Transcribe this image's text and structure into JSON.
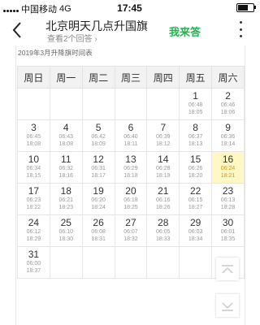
{
  "status_bar": {
    "carrier": "中国移动",
    "network": "4G",
    "time": "17:45"
  },
  "header": {
    "title": "北京明天几点升国旗",
    "subtitle": "查看2个回答",
    "subtitle_chevron": "›",
    "answer_button": "我来答",
    "back_icon": "chevron-left-icon",
    "more_icon": "more-vertical-icon"
  },
  "calendar": {
    "caption": "2019年3月升降旗时间表",
    "weekdays": [
      "周日",
      "周一",
      "周二",
      "周三",
      "周四",
      "周五",
      "周六"
    ],
    "highlight_day": "16",
    "highlight_color": "#fff8c4",
    "accent_color": "#1db84f",
    "weeks": [
      [
        null,
        null,
        null,
        null,
        null,
        {
          "day": "1",
          "rise": "06:48",
          "set": "18:05"
        },
        {
          "day": "2",
          "rise": "06:46",
          "set": "18:06"
        }
      ],
      [
        {
          "day": "3",
          "rise": "06:45",
          "set": "18:08"
        },
        {
          "day": "4",
          "rise": "06:43",
          "set": "18:08"
        },
        {
          "day": "5",
          "rise": "06:42",
          "set": "18:09"
        },
        {
          "day": "6",
          "rise": "06:40",
          "set": "18:11"
        },
        {
          "day": "7",
          "rise": "06:39",
          "set": "18:12"
        },
        {
          "day": "8",
          "rise": "06:37",
          "set": "18:13"
        },
        {
          "day": "9",
          "rise": "06:36",
          "set": "18:14"
        }
      ],
      [
        {
          "day": "10",
          "rise": "06:34",
          "set": "18:15"
        },
        {
          "day": "11",
          "rise": "06:32",
          "set": "18:16"
        },
        {
          "day": "12",
          "rise": "06:31",
          "set": "18:17"
        },
        {
          "day": "13",
          "rise": "06:29",
          "set": "18:18"
        },
        {
          "day": "14",
          "rise": "06:28",
          "set": "18:19"
        },
        {
          "day": "15",
          "rise": "06:26",
          "set": "18:20"
        },
        {
          "day": "16",
          "rise": "06:24",
          "set": "18:21"
        }
      ],
      [
        {
          "day": "17",
          "rise": "06:23",
          "set": "18:22"
        },
        {
          "day": "18",
          "rise": "06:21",
          "set": "18:23"
        },
        {
          "day": "19",
          "rise": "06:20",
          "set": "18:24"
        },
        {
          "day": "20",
          "rise": "06:18",
          "set": "18:25"
        },
        {
          "day": "21",
          "rise": "06:16",
          "set": "18:26"
        },
        {
          "day": "22",
          "rise": "06:15",
          "set": "18:27"
        },
        {
          "day": "23",
          "rise": "06:13",
          "set": "18:28"
        }
      ],
      [
        {
          "day": "24",
          "rise": "06:12",
          "set": "18:29"
        },
        {
          "day": "25",
          "rise": "06:10",
          "set": "18:30"
        },
        {
          "day": "26",
          "rise": "06:08",
          "set": "18:31"
        },
        {
          "day": "27",
          "rise": "06:07",
          "set": "18:32"
        },
        {
          "day": "28",
          "rise": "06:05",
          "set": "18:33"
        },
        {
          "day": "29",
          "rise": "06:03",
          "set": "18:34"
        },
        {
          "day": "30",
          "rise": "06:01",
          "set": "18:35"
        }
      ],
      [
        {
          "day": "31",
          "rise": "06:00",
          "set": "18:37"
        },
        null,
        null,
        null,
        null,
        null,
        null
      ]
    ]
  },
  "scroll_buttons": {
    "up_icon": "chevron-up-icon",
    "down_icon": "chevron-down-icon"
  }
}
